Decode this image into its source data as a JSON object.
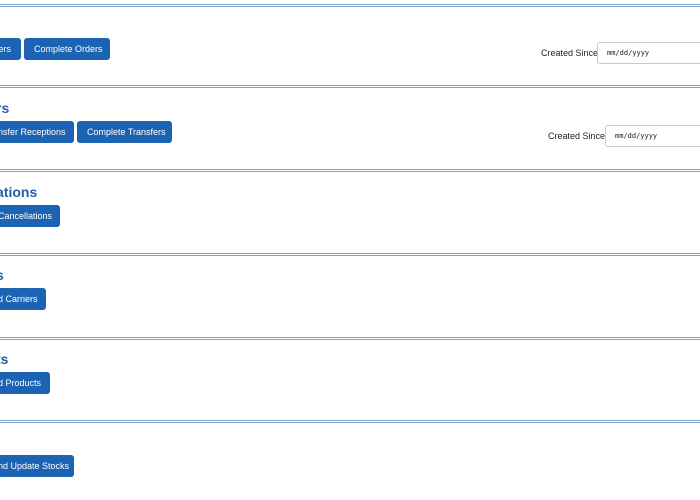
{
  "sections": [
    {
      "title": "",
      "buttons": [
        "ers",
        "Complete Orders"
      ],
      "filter": {
        "label": "Created Since",
        "placeholder": "mm/dd/yyyy"
      }
    },
    {
      "title": "rs",
      "buttons": [
        "nsfer Receptions",
        "Complete Transfers"
      ],
      "filter": {
        "label": "Created Since",
        "placeholder": "mm/dd/yyyy"
      }
    },
    {
      "title": "ations",
      "buttons": [
        "Cancellations"
      ]
    },
    {
      "title": "s",
      "buttons": [
        "d Carriers"
      ]
    },
    {
      "title": "ts",
      "buttons": [
        "d Products"
      ]
    },
    {
      "title": "",
      "buttons": [
        "nd Update Stocks"
      ]
    }
  ]
}
